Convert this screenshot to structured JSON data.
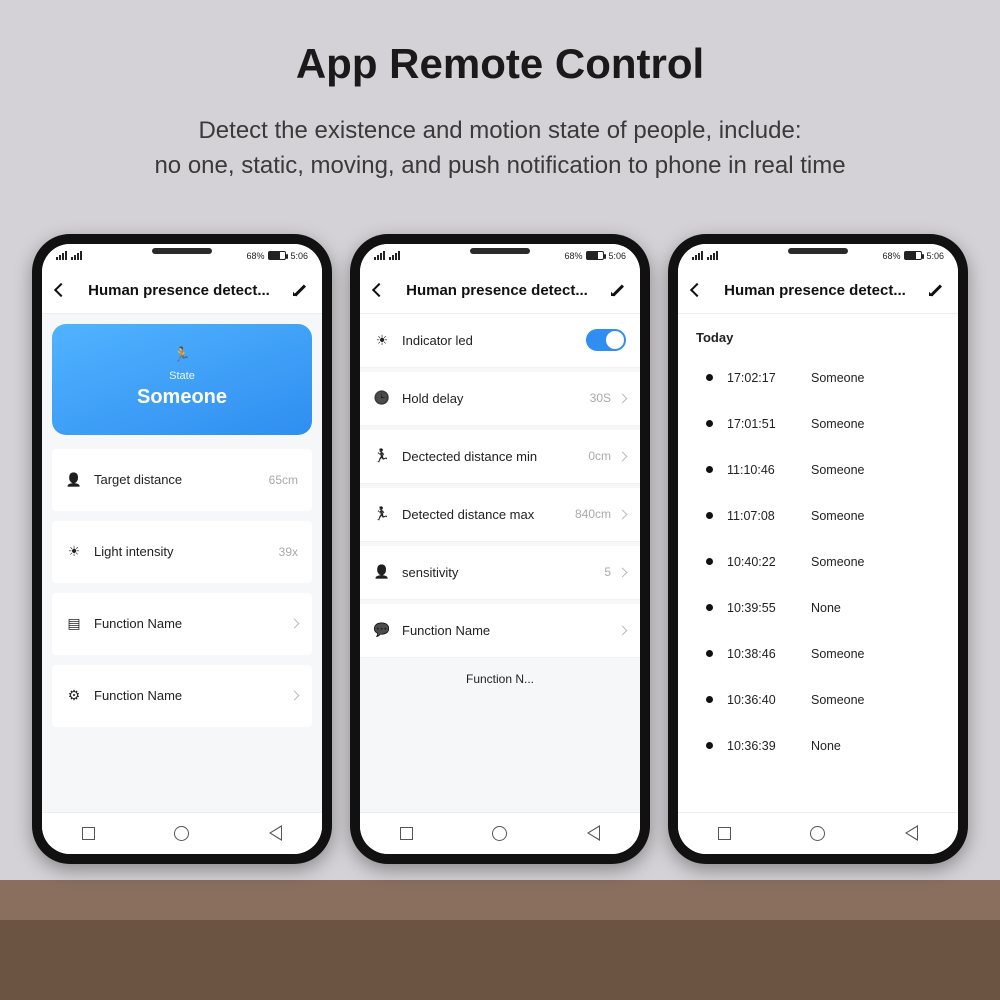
{
  "hero": {
    "title": "App Remote Control",
    "line1": "Detect the existence and motion state of people, include:",
    "line2": "no one, static, moving, and push notification to phone in real time"
  },
  "status": {
    "left": "▯▯ 4G",
    "battery_pct": "68%",
    "time": "5:06"
  },
  "appbar": {
    "title": "Human presence detect..."
  },
  "phone1": {
    "state": {
      "label": "State",
      "value": "Someone"
    },
    "rows": [
      {
        "icon": "person",
        "label": "Target distance",
        "value": "65cm",
        "chev": false
      },
      {
        "icon": "bright",
        "label": "Light intensity",
        "value": "39x",
        "chev": false
      },
      {
        "icon": "list",
        "label": "Function Name",
        "value": "",
        "chev": true
      },
      {
        "icon": "gear",
        "label": "Function Name",
        "value": "",
        "chev": true
      }
    ]
  },
  "phone2": {
    "rows": [
      {
        "icon": "bright",
        "label": "Indicator led",
        "type": "toggle",
        "on": true
      },
      {
        "icon": "clock",
        "label": "Hold delay",
        "value": "30S",
        "chev": true
      },
      {
        "icon": "run",
        "label": "Dectected distance min",
        "value": "0cm",
        "chev": true
      },
      {
        "icon": "run",
        "label": "Detected distance max",
        "value": "840cm",
        "chev": true
      },
      {
        "icon": "person",
        "label": "sensitivity",
        "value": "5",
        "chev": true
      },
      {
        "icon": "chat",
        "label": "Function Name",
        "value": "",
        "chev": true
      }
    ],
    "footer": "Function N..."
  },
  "phone3": {
    "heading": "Today",
    "log": [
      {
        "t": "17:02:17",
        "s": "Someone"
      },
      {
        "t": "17:01:51",
        "s": "Someone"
      },
      {
        "t": "11:10:46",
        "s": "Someone"
      },
      {
        "t": "11:07:08",
        "s": "Someone"
      },
      {
        "t": "10:40:22",
        "s": "Someone"
      },
      {
        "t": "10:39:55",
        "s": "None"
      },
      {
        "t": "10:38:46",
        "s": "Someone"
      },
      {
        "t": "10:36:40",
        "s": "Someone"
      },
      {
        "t": "10:36:39",
        "s": "None"
      }
    ]
  }
}
